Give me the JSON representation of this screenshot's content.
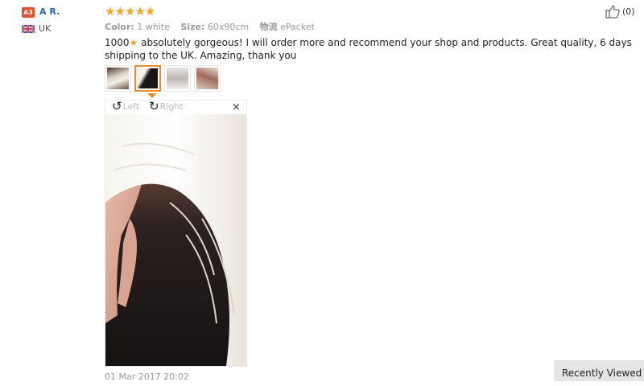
{
  "reviewer": {
    "avatar_label": "A3",
    "name": "A R.",
    "country": "UK"
  },
  "rating": {
    "stars": "★★★★★"
  },
  "order": {
    "color_label": "Color:",
    "color_value": "1 white",
    "size_label": "Size:",
    "size_value": "60x90cm",
    "shipping_label": "物流",
    "shipping_value": "ePacket"
  },
  "likes": {
    "count": "(0)"
  },
  "review": {
    "prefix": "1000",
    "star": "★",
    "text": " absolutely gorgeous! I will order more and recommend your shop and products. Great quality, 6 days shipping to the UK. Amazing, thank you"
  },
  "viewer": {
    "rotate_left": "Left",
    "rotate_right": "Right",
    "close": "×"
  },
  "date": "01 Mar 2017 20:02",
  "recently_viewed": "Recently Viewed",
  "colors": {
    "accent": "#f5a623",
    "name_link": "#2866b1",
    "selected_thumb": "#e88b2e"
  }
}
